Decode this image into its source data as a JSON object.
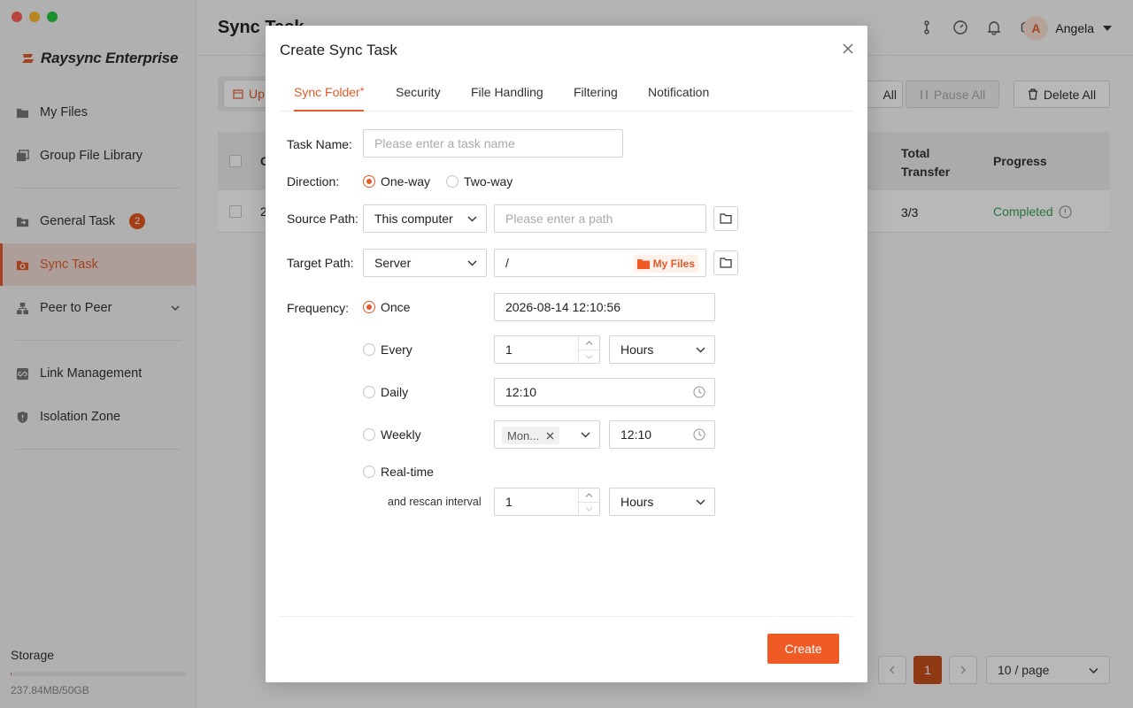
{
  "window": {
    "traffic_colors": [
      "#ff5f57",
      "#febc2e",
      "#28c840"
    ]
  },
  "app": {
    "brand": "Raysync Enterprise",
    "accent": "#e35b2c"
  },
  "sidebar": {
    "items": [
      {
        "label": "My Files",
        "icon": "folder-icon"
      },
      {
        "label": "Group File Library",
        "icon": "library-icon"
      },
      {
        "label": "General Task",
        "icon": "task-icon",
        "badge": "2"
      },
      {
        "label": "Sync Task",
        "icon": "sync-icon",
        "active": true
      },
      {
        "label": "Peer to Peer",
        "icon": "peer-icon"
      },
      {
        "label": "Link Management",
        "icon": "link-icon"
      },
      {
        "label": "Isolation Zone",
        "icon": "shield-icon"
      }
    ],
    "storage_label": "Storage",
    "storage_text": "237.84MB/50GB",
    "storage_used_fraction": 0.005
  },
  "header": {
    "title": "Sync Task",
    "user_initial": "A",
    "user_name": "Angela"
  },
  "toolbar": {
    "upload_partial": "Up",
    "all_partial": "All",
    "pause_all": "Pause All",
    "delete_all": "Delete All"
  },
  "table": {
    "headers": {
      "first_partial": "C",
      "total_transfer": "Total Transfer",
      "progress": "Progress"
    },
    "rows": [
      {
        "first_partial": "2",
        "total_transfer": "3/3",
        "progress": "Completed"
      }
    ]
  },
  "pagination": {
    "current": "1",
    "page_size": "10 / page"
  },
  "modal": {
    "title": "Create Sync Task",
    "tabs": [
      "Sync Folder",
      "Security",
      "File Handling",
      "Filtering",
      "Notification"
    ],
    "required_mark": "*",
    "task_name_label": "Task Name:",
    "task_name_placeholder": "Please enter a task name",
    "direction_label": "Direction:",
    "direction_options": [
      "One-way",
      "Two-way"
    ],
    "direction_selected": "One-way",
    "source_label": "Source Path:",
    "source_select": "This computer",
    "source_placeholder": "Please enter a path",
    "target_label": "Target Path:",
    "target_select": "Server",
    "target_path": "/",
    "target_tag": "My Files",
    "frequency_label": "Frequency:",
    "freq": {
      "once_label": "Once",
      "once_value": "2026-08-14 12:10:56",
      "every_label": "Every",
      "every_value": "1",
      "every_unit": "Hours",
      "daily_label": "Daily",
      "daily_time": "12:10",
      "weekly_label": "Weekly",
      "weekly_day": "Mon...",
      "weekly_time": "12:10",
      "realtime_label": "Real-time",
      "rescan_label": "and rescan interval",
      "rescan_value": "1",
      "rescan_unit": "Hours"
    },
    "selected_frequency": "Once",
    "create_button": "Create"
  }
}
